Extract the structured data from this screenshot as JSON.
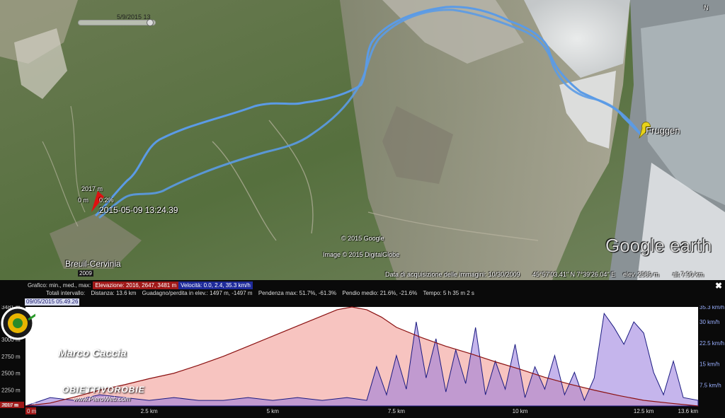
{
  "map": {
    "slider_date": "5/9/2015  13",
    "compass": "N",
    "labels": {
      "elevation_marker": "2017 m",
      "zero_marker": "0 m",
      "grade_marker": "0.2%",
      "timestamp": "2015-05-09 13:24.39",
      "town": "Breuil-Cervinia",
      "town_pin": "2009",
      "destination": "Fruggen"
    },
    "credits": {
      "copyright_google": "© 2015 Google",
      "copyright_image": "Image © 2015 DigitalGlobe",
      "logo_text": "Google earth"
    },
    "status_bar": {
      "acquisition": "Data di acquisizione delle immagini: 10/30/2009",
      "coordinates": "45°57'03.41\" N    7°39'26.04\" E",
      "elev": "elev. 2589 m",
      "alt": "alt  7.90 km"
    },
    "colors": {
      "track": "#5b9be6",
      "destination_pin": "#e8d21a",
      "start_pin": "#e01010"
    }
  },
  "profile": {
    "stats_row1": {
      "graph": "Grafico: min., med., max:",
      "elevation": "Elevazione: 2016, 2647, 3481 m",
      "speed": "Velocità: 0.0, 2.4, 35.3 km/h"
    },
    "stats_row2": {
      "totals": "Totali intervallo:",
      "distance": "Distanza: 13.6 km",
      "gain_loss": "Guadagno/perdita in elev.: 1497 m, -1497 m",
      "max_slope": "Pendenza max: 51.7%, -61.3%",
      "avg_slope": "Pendio medio: 21.6%, -21.6%",
      "time": "Tempo: 5 h 35 m 2 s"
    },
    "date": "09/05/2015 05.49.26",
    "close": "✖",
    "y_left_ticks": [
      "3481 m",
      "3250 m",
      "3000 m",
      "2750 m",
      "2500 m",
      "2250 m",
      "2017 m",
      "2016 m"
    ],
    "y_right_ticks": [
      "35.3 km/h",
      "30 km/h",
      "22.5 km/h",
      "15 km/h",
      "7.5 km/h"
    ],
    "x_ticks": [
      "0 m",
      "2.5 km",
      "5 km",
      "7.5 km",
      "10 km",
      "12.5 km",
      "13.6 km"
    ],
    "left_marker": "0 %",
    "watermark_name": "Marco Caccia",
    "watermark_site": "OBIETTIVOROBIE",
    "watermark_url": "www.PieroWeb.com"
  },
  "chart_data": {
    "type": "area",
    "x_unit": "km",
    "xlim": [
      0,
      13.6
    ],
    "series": [
      {
        "name": "Elevazione",
        "unit": "m",
        "ylim": [
          2016,
          3481
        ],
        "x": [
          0,
          0.5,
          1,
          1.5,
          2,
          2.5,
          3,
          3.5,
          4,
          4.5,
          5,
          5.5,
          6,
          6.3,
          6.6,
          6.9,
          7.2,
          7.5,
          8,
          8.5,
          9,
          9.5,
          10,
          10.5,
          11,
          11.5,
          12,
          12.5,
          13,
          13.6
        ],
        "values": [
          2017,
          2060,
          2150,
          2250,
          2330,
          2420,
          2500,
          2620,
          2750,
          2900,
          3050,
          3200,
          3350,
          3440,
          3481,
          3440,
          3330,
          3180,
          3030,
          2900,
          2790,
          2670,
          2560,
          2440,
          2340,
          2250,
          2170,
          2100,
          2060,
          2016
        ]
      },
      {
        "name": "Velocità",
        "unit": "km/h",
        "ylim": [
          0,
          35.3
        ],
        "x": [
          0,
          0.5,
          1,
          1.5,
          2,
          2.5,
          3,
          3.5,
          4,
          4.5,
          5,
          5.5,
          6,
          6.5,
          6.9,
          7.1,
          7.3,
          7.5,
          7.7,
          7.9,
          8.1,
          8.3,
          8.5,
          8.7,
          8.9,
          9.1,
          9.3,
          9.5,
          9.7,
          9.9,
          10.1,
          10.3,
          10.5,
          10.7,
          10.9,
          11.1,
          11.3,
          11.5,
          11.7,
          11.9,
          12.1,
          12.3,
          12.5,
          12.7,
          12.9,
          13.1,
          13.3,
          13.6
        ],
        "values": [
          0,
          3,
          2,
          4,
          3,
          2,
          3,
          2,
          2,
          3,
          2,
          3,
          2,
          3,
          2,
          14,
          4,
          18,
          6,
          30,
          10,
          24,
          5,
          20,
          8,
          28,
          4,
          16,
          6,
          22,
          3,
          14,
          6,
          18,
          4,
          12,
          2,
          10,
          33,
          28,
          22,
          30,
          26,
          12,
          4,
          16,
          3,
          2
        ]
      }
    ],
    "y_left_label": "m",
    "y_right_label": "km/h",
    "grid": false,
    "legend": "top-left"
  }
}
